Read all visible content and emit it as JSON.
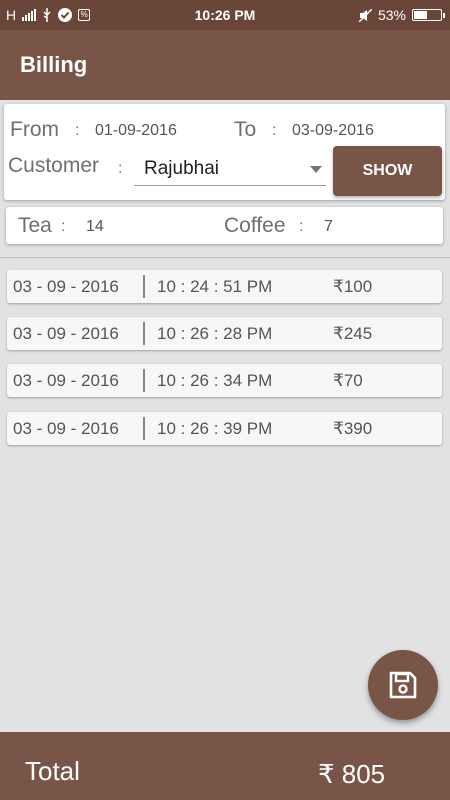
{
  "status_bar": {
    "network": "H",
    "time": "10:26 PM",
    "battery": "53%",
    "battery_fraction": 0.53,
    "icons": [
      "signal-icon",
      "usb-icon",
      "check-circle-icon",
      "percent-box-icon",
      "mute-icon",
      "battery-icon"
    ]
  },
  "app_bar": {
    "title": "Billing"
  },
  "filter": {
    "from_label": "From",
    "from_value": "01-09-2016",
    "to_label": "To",
    "to_value": "03-09-2016",
    "customer_label": "Customer",
    "customer_value": "Rajubhai",
    "show_label": "SHOW",
    "colon": ":"
  },
  "summary": {
    "tea_label": "Tea",
    "tea_value": "14",
    "coffee_label": "Coffee",
    "coffee_value": "7"
  },
  "records": [
    {
      "date": "03 - 09 - 2016",
      "time": "10 : 24 : 51 PM",
      "amount": "₹100"
    },
    {
      "date": "03 - 09 - 2016",
      "time": "10 : 26 : 28 PM",
      "amount": "₹245"
    },
    {
      "date": "03 - 09 - 2016",
      "time": "10 : 26 : 34 PM",
      "amount": "₹70"
    },
    {
      "date": "03 - 09 - 2016",
      "time": "10 : 26 : 39 PM",
      "amount": "₹390"
    }
  ],
  "fab": {
    "icon": "save-icon"
  },
  "footer": {
    "total_label": "Total",
    "total_value": "₹ 805"
  },
  "colors": {
    "primary": "#795548",
    "status_bar": "#6a4638",
    "background": "#e2e2e2"
  }
}
